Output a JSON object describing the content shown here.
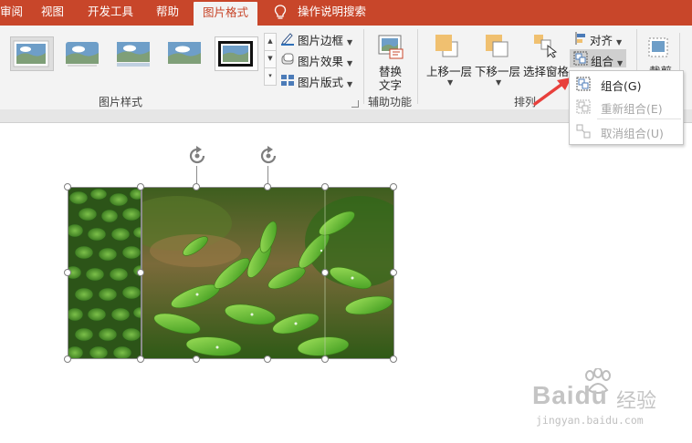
{
  "tabs": [
    {
      "label": "审阅",
      "active": false
    },
    {
      "label": "视图",
      "active": false
    },
    {
      "label": "开发工具",
      "active": false
    },
    {
      "label": "帮助",
      "active": false
    },
    {
      "label": "图片格式",
      "active": true
    }
  ],
  "search": {
    "label": "操作说明搜索",
    "icon": "lightbulb-icon"
  },
  "ribbon": {
    "picture_styles": {
      "group_label": "图片样式",
      "border_label": "图片边框",
      "effects_label": "图片效果",
      "layout_label": "图片版式"
    },
    "accessibility": {
      "group_label": "辅助功能",
      "alt_text_label_line1": "替换",
      "alt_text_label_line2": "文字"
    },
    "arrange": {
      "group_label": "排列",
      "bring_forward_label": "上移一层",
      "send_backward_label": "下移一层",
      "selection_pane_label": "选择窗格",
      "align_label": "对齐",
      "group_label_btn": "组合"
    },
    "size": {
      "crop_label": "裁剪"
    }
  },
  "group_menu": {
    "items": [
      {
        "label": "组合(G)",
        "disabled": false
      },
      {
        "label": "重新组合(E)",
        "disabled": true
      },
      {
        "label": "取消组合(U)",
        "disabled": true
      }
    ]
  },
  "watermark": {
    "brand": "Baidu",
    "cn": "经验",
    "url": "jingyan.baidu.com"
  },
  "colors": {
    "accent": "#c8462a",
    "ribbon_bg": "#f3f3f3",
    "arrow": "#e8403c",
    "disabled_text": "#a6a6a6"
  }
}
